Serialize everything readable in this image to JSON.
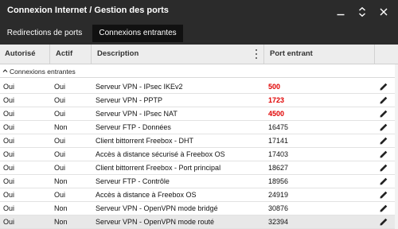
{
  "window": {
    "title": "Connexion Internet / Gestion des ports"
  },
  "tabs": [
    {
      "label": "Redirections de ports",
      "active": false
    },
    {
      "label": "Connexions entrantes",
      "active": true
    }
  ],
  "table": {
    "headers": {
      "autorise": "Autorisé",
      "actif": "Actif",
      "description": "Description",
      "port": "Port entrant"
    },
    "group_label": "Connexions entrantes",
    "rows": [
      {
        "autorise": "Oui",
        "actif": "Oui",
        "description": "Serveur VPN - IPsec IKEv2",
        "port": "500",
        "highlight": true
      },
      {
        "autorise": "Oui",
        "actif": "Oui",
        "description": "Serveur VPN - PPTP",
        "port": "1723",
        "highlight": true
      },
      {
        "autorise": "Oui",
        "actif": "Oui",
        "description": "Serveur VPN - IPsec NAT",
        "port": "4500",
        "highlight": true
      },
      {
        "autorise": "Oui",
        "actif": "Non",
        "description": "Serveur FTP - Données",
        "port": "16475",
        "highlight": false
      },
      {
        "autorise": "Oui",
        "actif": "Oui",
        "description": "Client bittorrent Freebox - DHT",
        "port": "17141",
        "highlight": false
      },
      {
        "autorise": "Oui",
        "actif": "Oui",
        "description": "Accès à distance sécurisé à Freebox OS",
        "port": "17403",
        "highlight": false
      },
      {
        "autorise": "Oui",
        "actif": "Oui",
        "description": "Client bittorrent Freebox - Port principal",
        "port": "18627",
        "highlight": false
      },
      {
        "autorise": "Oui",
        "actif": "Non",
        "description": "Serveur FTP - Contrôle",
        "port": "18956",
        "highlight": false
      },
      {
        "autorise": "Oui",
        "actif": "Oui",
        "description": "Accès à distance à Freebox OS",
        "port": "24919",
        "highlight": false
      },
      {
        "autorise": "Oui",
        "actif": "Non",
        "description": "Serveur VPN - OpenVPN mode bridgé",
        "port": "30876",
        "highlight": false
      },
      {
        "autorise": "Oui",
        "actif": "Non",
        "description": "Serveur VPN - OpenVPN mode routé",
        "port": "32394",
        "highlight": false,
        "selected": true
      }
    ]
  },
  "colors": {
    "titlebar": "#2b2b2b",
    "active_tab": "#111111",
    "highlight_port": "#e00000"
  },
  "icons": {
    "minimize": "minimize-icon",
    "maximize": "expand-icon",
    "close": "close-icon",
    "column_menu": "kebab-menu-icon",
    "group_toggle": "chevron-up-icon",
    "row_edit": "pencil-icon"
  }
}
